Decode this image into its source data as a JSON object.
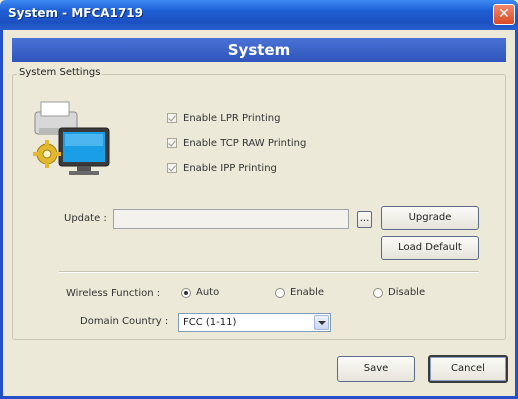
{
  "window": {
    "title": "System - MFCA1719",
    "close_glyph": "✕"
  },
  "header": {
    "title": "System"
  },
  "system_settings": {
    "legend": "System Settings",
    "icon": "printer-computer-icon",
    "checkboxes": [
      {
        "label": "Enable LPR Printing",
        "checked": true,
        "disabled": true
      },
      {
        "label": "Enable TCP RAW Printing",
        "checked": true,
        "disabled": true
      },
      {
        "label": "Enable IPP Printing",
        "checked": true,
        "disabled": true
      }
    ],
    "update": {
      "label": "Update :",
      "value": "",
      "browse_label": "...",
      "upgrade_label": "Upgrade",
      "load_default_label": "Load Default"
    },
    "wireless": {
      "label": "Wireless Function :",
      "options": [
        "Auto",
        "Enable",
        "Disable"
      ],
      "selected": "Auto"
    },
    "domain": {
      "label": "Domain Country :",
      "selected": "FCC (1-11)"
    }
  },
  "footer": {
    "save_label": "Save",
    "cancel_label": "Cancel"
  },
  "colors": {
    "titlebar": "#1f5fd6",
    "header_banner": "#2f55bd",
    "dialog_bg": "#ece9d8",
    "close_button": "#d84a28"
  }
}
